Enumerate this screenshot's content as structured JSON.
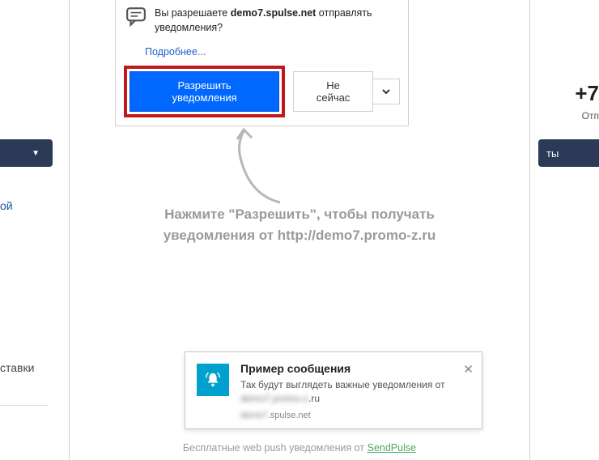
{
  "permission": {
    "question_prefix": "Вы разрешаете ",
    "domain": "demo7.spulse.net",
    "question_suffix": " отправлять уведомления?",
    "more": "Подробнее...",
    "allow": "Разрешить уведомления",
    "not_now": "Не сейчас"
  },
  "instruction": {
    "line1": "Нажмите \"Разрешить\", чтобы получать",
    "line2": "уведомления от http://demo7.promo-z.ru"
  },
  "sample": {
    "title": "Пример сообщения",
    "desc": "Так будут выглядеть важные уведомления от",
    "from_domain_suffix": ".ru",
    "push_domain": ".spulse.net"
  },
  "footer": {
    "text": "Бесплатные web push уведомления от ",
    "link": "SendPulse"
  },
  "bg": {
    "left_word1": "ой",
    "left_word2": "ставки",
    "phone": "+7",
    "phone_sub": "Отп",
    "right_btn": "ты"
  }
}
